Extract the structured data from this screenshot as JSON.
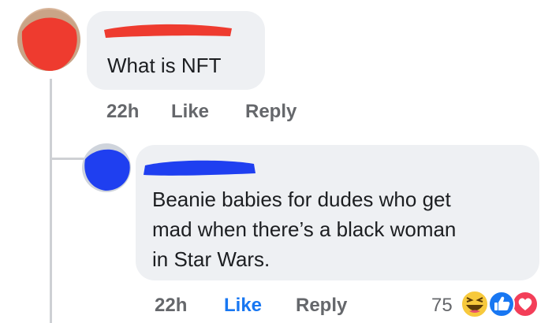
{
  "thread": {
    "comment": {
      "text": "What is NFT",
      "time": "22h",
      "like_label": "Like",
      "reply_label": "Reply"
    },
    "reply": {
      "text_lines": [
        "Beanie babies for dudes who get",
        "mad when there’s a black woman",
        "in Star Wars."
      ],
      "time": "22h",
      "like_label": "Like",
      "reply_label": "Reply",
      "reaction_count": "75",
      "reactions": [
        "haha-icon",
        "like-icon",
        "love-icon"
      ]
    }
  },
  "colors": {
    "bubble": "#eef0f3",
    "meta_text": "#65676b",
    "like_active": "#1877f2",
    "redaction_red": "#ee3b2f",
    "redaction_blue": "#1f3ff0"
  }
}
